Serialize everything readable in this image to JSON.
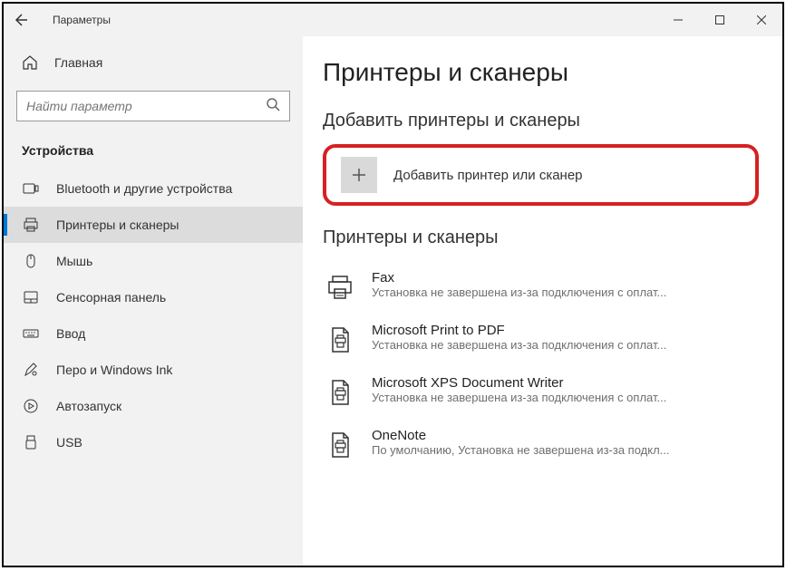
{
  "window": {
    "title": "Параметры"
  },
  "sidebar": {
    "home": "Главная",
    "search_placeholder": "Найти параметр",
    "section": "Устройства",
    "items": [
      {
        "label": "Bluetooth и другие устройства"
      },
      {
        "label": "Принтеры и сканеры"
      },
      {
        "label": "Мышь"
      },
      {
        "label": "Сенсорная панель"
      },
      {
        "label": "Ввод"
      },
      {
        "label": "Перо и Windows Ink"
      },
      {
        "label": "Автозапуск"
      },
      {
        "label": "USB"
      }
    ]
  },
  "main": {
    "title": "Принтеры и сканеры",
    "add_heading": "Добавить принтеры и сканеры",
    "add_button": "Добавить принтер или сканер",
    "list_heading": "Принтеры и сканеры",
    "printers": [
      {
        "name": "Fax",
        "status": "Установка не завершена из-за подключения с оплат..."
      },
      {
        "name": "Microsoft Print to PDF",
        "status": "Установка не завершена из-за подключения с оплат..."
      },
      {
        "name": "Microsoft XPS Document Writer",
        "status": "Установка не завершена из-за подключения с оплат..."
      },
      {
        "name": "OneNote",
        "status": "По умолчанию, Установка не завершена из-за подкл..."
      }
    ]
  }
}
